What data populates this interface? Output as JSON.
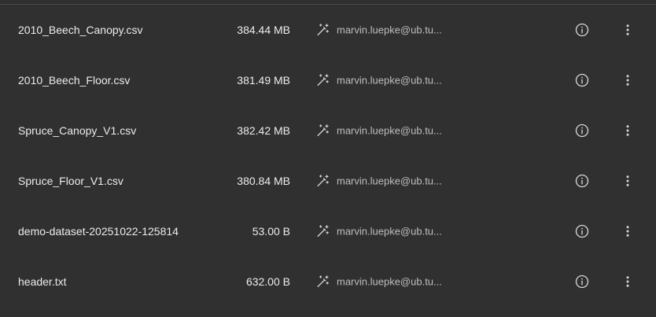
{
  "files": [
    {
      "name": "2010_Beech_Canopy.csv",
      "size": "384.44 MB",
      "owner": "marvin.luepke@ub.tu..."
    },
    {
      "name": "2010_Beech_Floor.csv",
      "size": "381.49 MB",
      "owner": "marvin.luepke@ub.tu..."
    },
    {
      "name": "Spruce_Canopy_V1.csv",
      "size": "382.42 MB",
      "owner": "marvin.luepke@ub.tu..."
    },
    {
      "name": "Spruce_Floor_V1.csv",
      "size": "380.84 MB",
      "owner": "marvin.luepke@ub.tu..."
    },
    {
      "name": "demo-dataset-20251022-125814",
      "size": "53.00 B",
      "owner": "marvin.luepke@ub.tu..."
    },
    {
      "name": "header.txt",
      "size": "632.00 B",
      "owner": "marvin.luepke@ub.tu..."
    }
  ],
  "icons": {
    "owner": "magic-wand-icon",
    "info": "info-circle-icon",
    "more": "more-vert-icon"
  },
  "colors": {
    "background": "#303030",
    "text": "#ececec",
    "muted_text": "#bdbdbd",
    "icon": "#d6d6d6"
  }
}
